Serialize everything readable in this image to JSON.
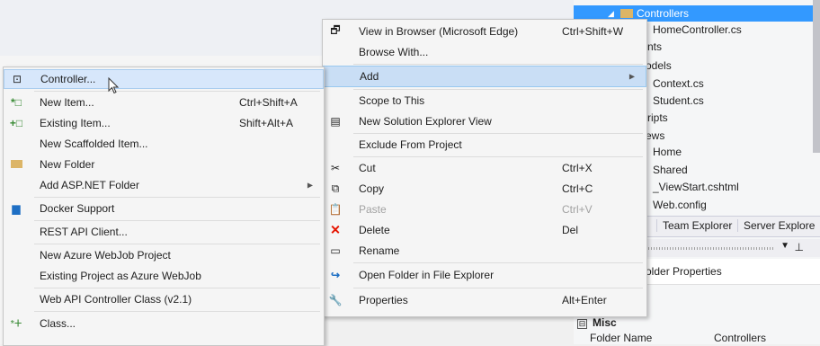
{
  "solution_explorer": {
    "tree": [
      {
        "label": "Controllers",
        "selected": true
      },
      {
        "label": "HomeController.cs"
      },
      {
        "label": "nts"
      },
      {
        "label": "odels"
      },
      {
        "label": "Context.cs"
      },
      {
        "label": "Student.cs"
      },
      {
        "label": "ripts"
      },
      {
        "label": "ews"
      },
      {
        "label": "Home"
      },
      {
        "label": "Shared"
      },
      {
        "label": "_ViewStart.cshtml"
      },
      {
        "label": "Web.config"
      }
    ],
    "tabs": [
      "Team Explorer",
      "Server Explore"
    ],
    "properties_title": "older Properties",
    "misc_label": "Misc",
    "misc_toggle": "⊟",
    "property": {
      "name": "Folder Name",
      "value": "Controllers"
    },
    "pin_icon": "pin-icon",
    "dropdown_icon": "dropdown-icon"
  },
  "main_menu": {
    "items": [
      {
        "label": "View in Browser (Microsoft Edge)",
        "shortcut": "Ctrl+Shift+W",
        "icon": "browser-icon"
      },
      {
        "label": "Browse With...",
        "shortcut": ""
      },
      {
        "label": "Add",
        "shortcut": "",
        "submenu": true,
        "highlighted": true
      },
      {
        "label": "Scope to This",
        "shortcut": ""
      },
      {
        "label": "New Solution Explorer View",
        "shortcut": "",
        "icon": "solution-explorer-icon"
      },
      {
        "label": "Exclude From Project",
        "shortcut": ""
      },
      {
        "label": "Cut",
        "shortcut": "Ctrl+X",
        "icon": "scissors-icon"
      },
      {
        "label": "Copy",
        "shortcut": "Ctrl+C",
        "icon": "copy-icon"
      },
      {
        "label": "Paste",
        "shortcut": "Ctrl+V",
        "icon": "paste-icon",
        "disabled": true
      },
      {
        "label": "Delete",
        "shortcut": "Del",
        "icon": "delete-icon"
      },
      {
        "label": "Rename",
        "shortcut": "",
        "icon": "rename-icon"
      },
      {
        "label": "Open Folder in File Explorer",
        "shortcut": "",
        "icon": "open-folder-icon"
      },
      {
        "label": "Properties",
        "shortcut": "Alt+Enter",
        "icon": "wrench-icon"
      }
    ]
  },
  "add_submenu": {
    "items": [
      {
        "label": "Controller...",
        "shortcut": "",
        "icon": "controller-icon",
        "highlighted": true
      },
      {
        "label": "New Item...",
        "shortcut": "Ctrl+Shift+A",
        "icon": "new-item-icon"
      },
      {
        "label": "Existing Item...",
        "shortcut": "Shift+Alt+A",
        "icon": "existing-item-icon"
      },
      {
        "label": "New Scaffolded Item...",
        "shortcut": ""
      },
      {
        "label": "New Folder",
        "shortcut": "",
        "icon": "folder-icon"
      },
      {
        "label": "Add ASP.NET Folder",
        "shortcut": "",
        "submenu": true
      },
      {
        "label": "Docker Support",
        "shortcut": "",
        "icon": "docker-icon"
      },
      {
        "label": "REST API Client...",
        "shortcut": ""
      },
      {
        "label": "New Azure WebJob Project",
        "shortcut": ""
      },
      {
        "label": "Existing Project as Azure WebJob",
        "shortcut": ""
      },
      {
        "label": "Web API Controller Class (v2.1)",
        "shortcut": ""
      },
      {
        "label": "Class...",
        "shortcut": "",
        "icon": "class-icon"
      }
    ]
  },
  "colors": {
    "selection": "#3399ff",
    "menu_highlight": "#c9def5",
    "delete_red": "#e51400",
    "accent_blue": "#1e6fc4"
  }
}
